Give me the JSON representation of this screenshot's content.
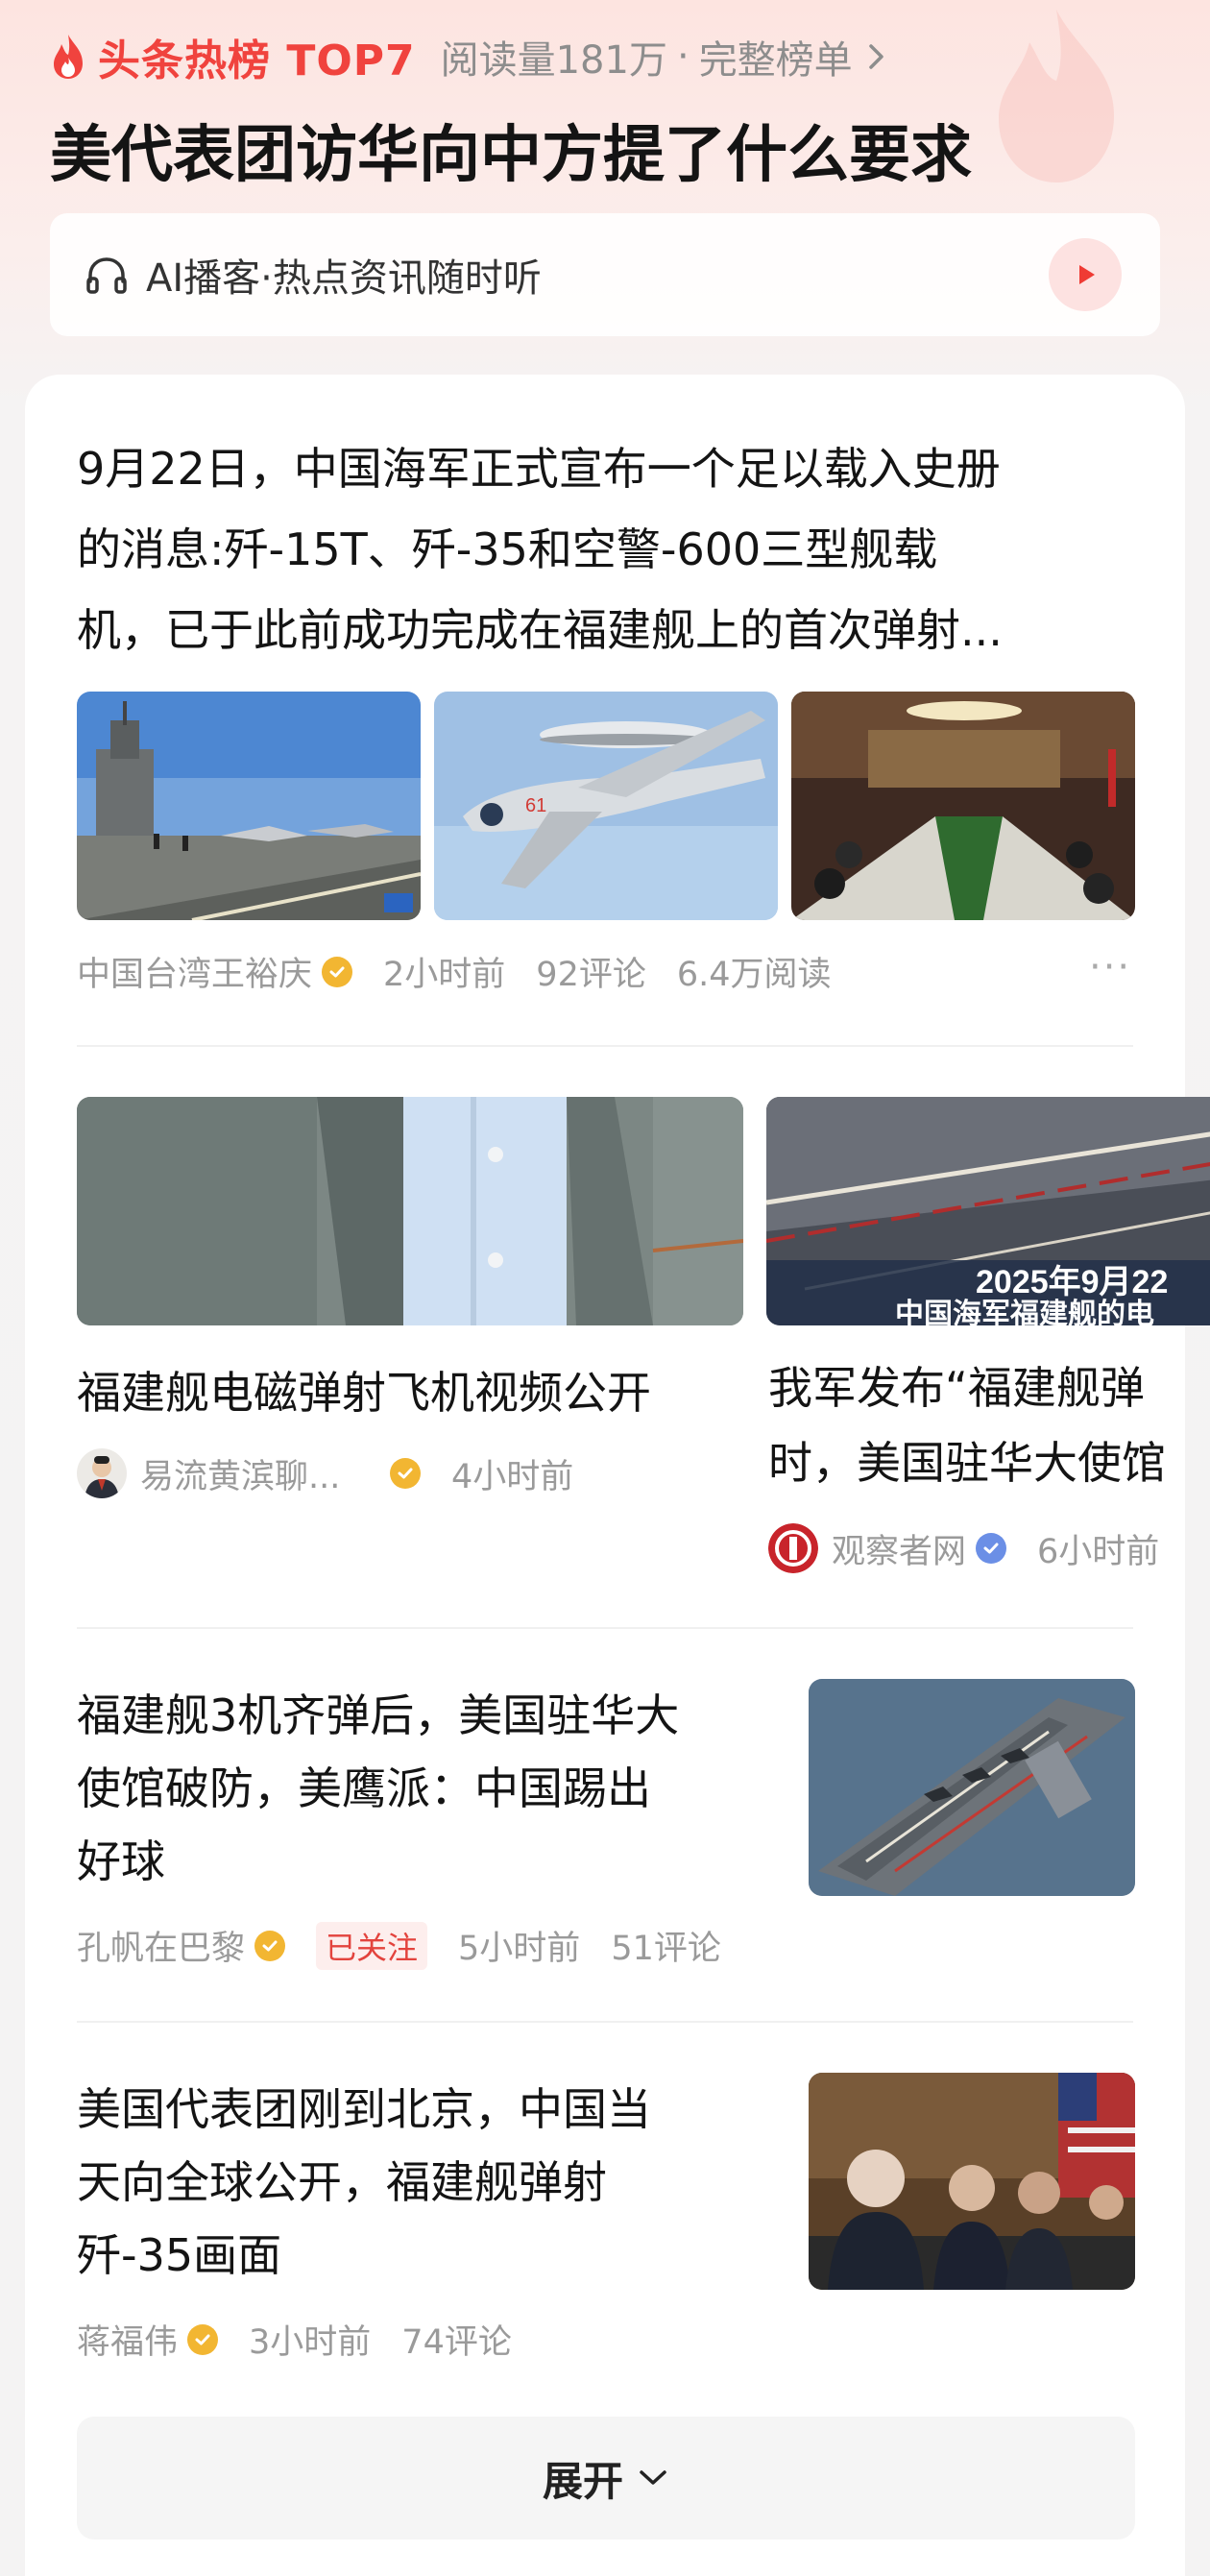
{
  "header": {
    "hot_label": "头条热榜 TOP7",
    "read_count": "阅读量181万",
    "separator": "·",
    "full_list": "完整榜单",
    "title": "美代表团访华向中方提了什么要求"
  },
  "ai_bar": {
    "text": "AI播客·热点资讯随时听"
  },
  "articles": [
    {
      "text": "9月22日，中国海军正式宣布一个足以载入史册的消息:歼-15T、歼-35和空警-600三型舰载机，已于此前成功完成在福建舰上的首次弹射...",
      "line1": "9月22日，中国海军正式宣布一个足以载入史册",
      "line2": "的消息:歼-15T、歼-35和空警-600三型舰载",
      "line3": "机，已于此前成功完成在福建舰上的首次弹射...",
      "author": "中国台湾王裕庆",
      "time": "2小时前",
      "comments": "92评论",
      "reads": "6.4万阅读",
      "more": "···"
    },
    {
      "title": "福建舰电磁弹射飞机视频公开",
      "author": "易流黄滨聊...",
      "time": "4小时前"
    },
    {
      "line1": "我军发布“福建舰弹",
      "line2": "时，美国驻华大使馆",
      "author": "观察者网",
      "time": "6小时前",
      "overlay_line1": "2025年9月22",
      "overlay_line2": "中国海军福建舰的电"
    },
    {
      "line1": "福建舰3机齐弹后，美国驻华大",
      "line2": "使馆破防，美鹰派：中国踢出",
      "line3": "好球",
      "author": "孔帆在巴黎",
      "followed": "已关注",
      "time": "5小时前",
      "comments": "51评论"
    },
    {
      "line1": "美国代表团刚到北京，中国当",
      "line2": "天向全球公开，福建舰弹射",
      "line3": "歼-35画面",
      "author": "蒋福伟",
      "time": "3小时前",
      "comments": "74评论"
    }
  ],
  "expand": {
    "label": "展开"
  },
  "colors": {
    "accent_red": "#f0433e",
    "verified_gold": "#f2b632",
    "verified_blue": "#6b8fe6"
  },
  "icons": [
    "flame-icon",
    "chevron-right-icon",
    "headphones-icon",
    "play-icon",
    "verified-icon",
    "chevron-down-icon"
  ]
}
